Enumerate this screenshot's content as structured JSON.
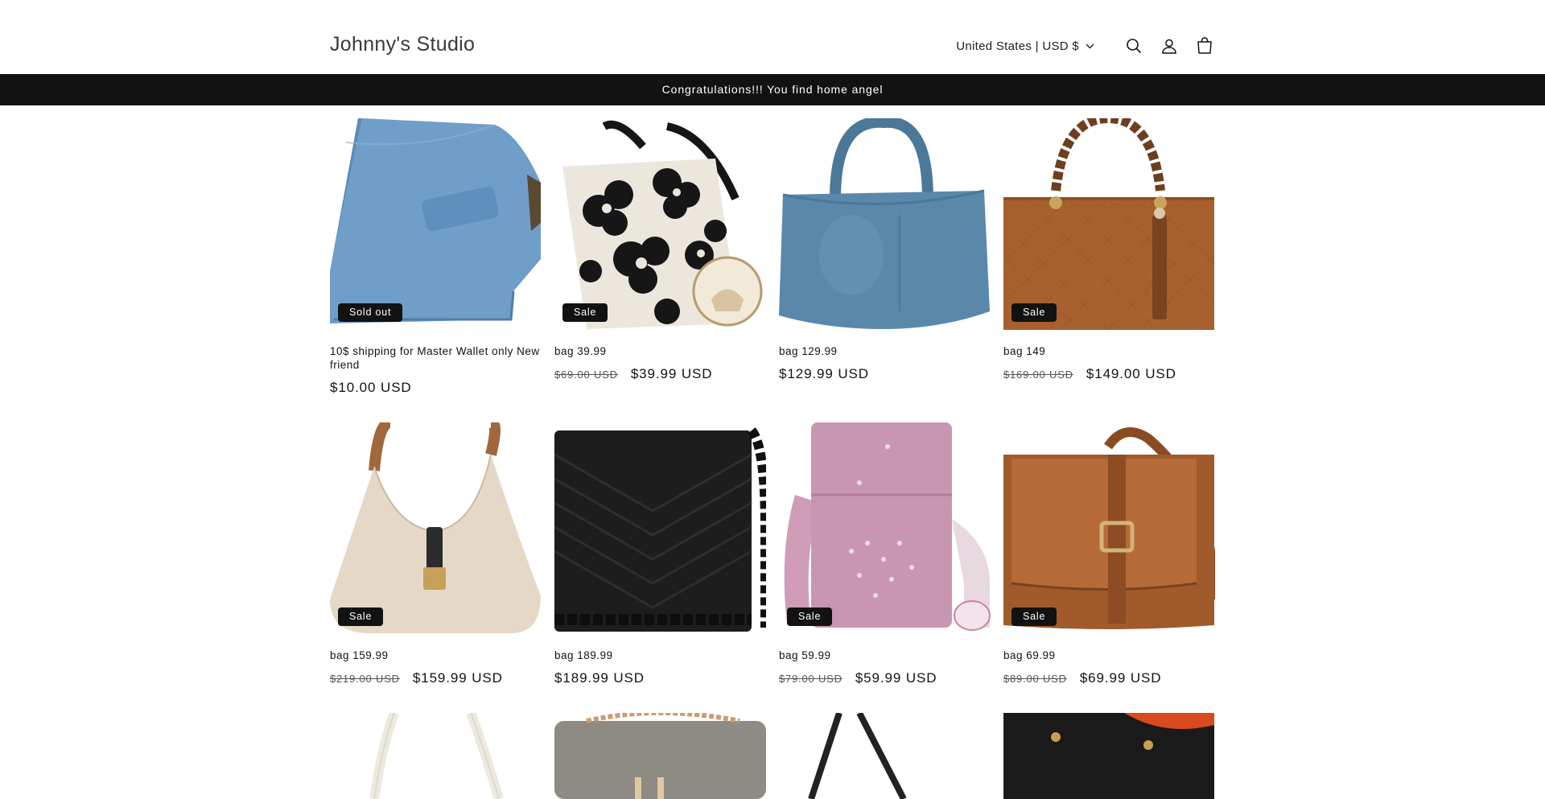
{
  "header": {
    "brand": "Johnny's Studio",
    "country_selector": "United States | USD $",
    "icons": [
      "search-icon",
      "account-icon",
      "cart-icon"
    ]
  },
  "announcement": "Congratulations!!! You find home angel",
  "products": [
    {
      "title": "10$ shipping for Master Wallet only New friend",
      "price": "$10.00 USD",
      "compare_price": "",
      "badge": "Sold out"
    },
    {
      "title": "bag 39.99",
      "price": "$39.99 USD",
      "compare_price": "$69.00 USD",
      "badge": "Sale"
    },
    {
      "title": "bag 129.99",
      "price": "$129.99 USD",
      "compare_price": "",
      "badge": ""
    },
    {
      "title": "bag 149",
      "price": "$149.00 USD",
      "compare_price": "$169.00 USD",
      "badge": "Sale"
    },
    {
      "title": "bag 159.99",
      "price": "$159.99 USD",
      "compare_price": "$219.00 USD",
      "badge": "Sale"
    },
    {
      "title": "bag 189.99",
      "price": "$189.99 USD",
      "compare_price": "",
      "badge": ""
    },
    {
      "title": "bag 59.99",
      "price": "$59.99 USD",
      "compare_price": "$79.00 USD",
      "badge": "Sale"
    },
    {
      "title": "bag 69.99",
      "price": "$69.99 USD",
      "compare_price": "$89.00 USD",
      "badge": "Sale"
    }
  ],
  "colors": {
    "announcement_bg": "#121212",
    "badge_bg": "#121212",
    "text": "#121212"
  }
}
